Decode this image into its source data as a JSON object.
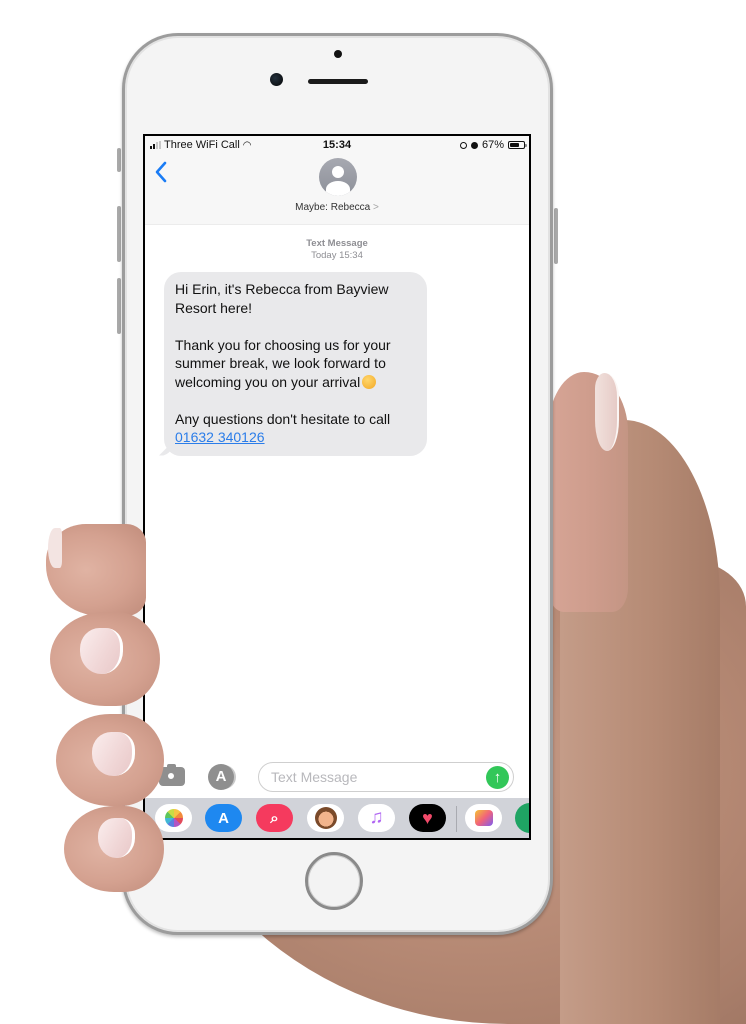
{
  "status_bar": {
    "carrier": "Three WiFi Call",
    "time": "15:34",
    "battery_percent": "67%",
    "battery_level": 0.67,
    "icons": [
      "signal-icon",
      "wifi-icon",
      "orientation-lock-icon",
      "alarm-icon",
      "battery-icon"
    ]
  },
  "header": {
    "back_icon": "chevron-left-icon",
    "contact_name": "Maybe: Rebecca",
    "contact_chevron": ">",
    "avatar_icon": "person-silhouette-icon"
  },
  "conversation": {
    "meta_label": "Text Message",
    "meta_time": "Today 15:34",
    "messages": [
      {
        "direction": "incoming",
        "paragraphs": [
          "Hi Erin, it's Rebecca from Bayview Resort here!",
          "Thank you for choosing us for your summer break, we look forward to welcoming you on your arrival",
          "Any questions don't hesitate to call"
        ],
        "emoji": "smiling-face-emoji",
        "phone_link": "01632 340126"
      }
    ]
  },
  "compose": {
    "camera_icon": "camera-icon",
    "apps_icon": "app-store-icon",
    "placeholder": "Text Message",
    "value": "",
    "send_icon": "arrow-up-icon",
    "apps_glyph": "A",
    "send_glyph": "↑"
  },
  "app_drawer": {
    "apps": [
      {
        "name": "Photos",
        "icon": "photos-icon"
      },
      {
        "name": "App Store",
        "icon": "app-store-icon",
        "glyph": "A"
      },
      {
        "name": "Images Search",
        "icon": "globe-search-icon",
        "glyph": "⌕"
      },
      {
        "name": "Memoji",
        "icon": "memoji-icon"
      },
      {
        "name": "Music",
        "icon": "music-note-icon",
        "glyph": "♫"
      },
      {
        "name": "Digital Touch",
        "icon": "heart-icon",
        "glyph": "♥"
      },
      {
        "name": "Collage",
        "icon": "photo-collage-icon"
      },
      {
        "name": "Maps",
        "icon": "maps-icon"
      }
    ]
  },
  "colors": {
    "accent_blue": "#1a7cf5",
    "link_blue": "#2b7de9",
    "send_green": "#32c759",
    "bubble_gray": "#e9e9eb",
    "phone_body": "#f4f4f4"
  }
}
